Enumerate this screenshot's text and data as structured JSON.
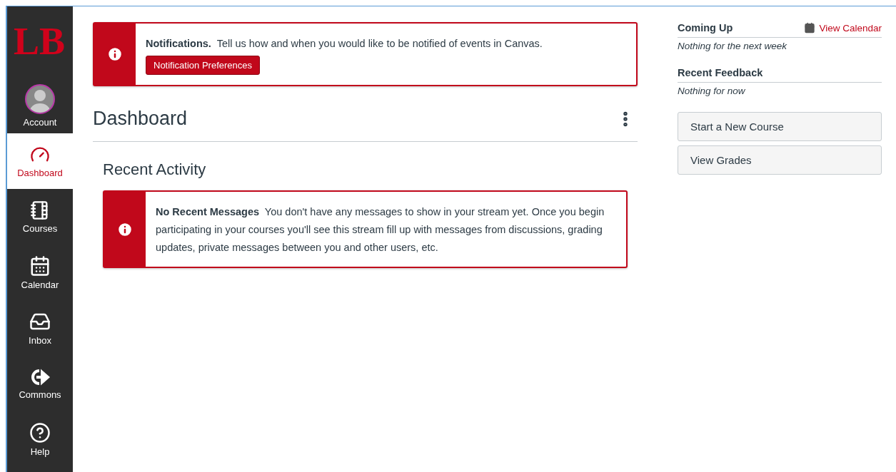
{
  "sidebar": {
    "logo": "LB",
    "items": [
      {
        "kind": "account",
        "label": "Account",
        "selected": false
      },
      {
        "kind": "dashboard",
        "label": "Dashboard",
        "selected": true
      },
      {
        "kind": "courses",
        "label": "Courses",
        "selected": false
      },
      {
        "kind": "calendar",
        "label": "Calendar",
        "selected": false
      },
      {
        "kind": "inbox",
        "label": "Inbox",
        "selected": false
      },
      {
        "kind": "commons",
        "label": "Commons",
        "selected": false
      },
      {
        "kind": "help",
        "label": "Help",
        "selected": false
      }
    ]
  },
  "notification": {
    "title": "Notifications.",
    "text": "Tell us how and when you would like to be notified of events in Canvas.",
    "button": "Notification Preferences"
  },
  "page_title": "Dashboard",
  "recent_activity": {
    "heading": "Recent Activity",
    "title": "No Recent Messages",
    "text": "You don't have any messages to show in your stream yet. Once you begin participating in your courses you'll see this stream fill up with messages from discussions, grading updates, private messages between you and other users, etc."
  },
  "right": {
    "coming_up": {
      "heading": "Coming Up",
      "link": "View Calendar",
      "empty": "Nothing for the next week"
    },
    "recent_feedback": {
      "heading": "Recent Feedback",
      "empty": "Nothing for now"
    },
    "buttons": [
      "Start a New Course",
      "View Grades"
    ]
  }
}
